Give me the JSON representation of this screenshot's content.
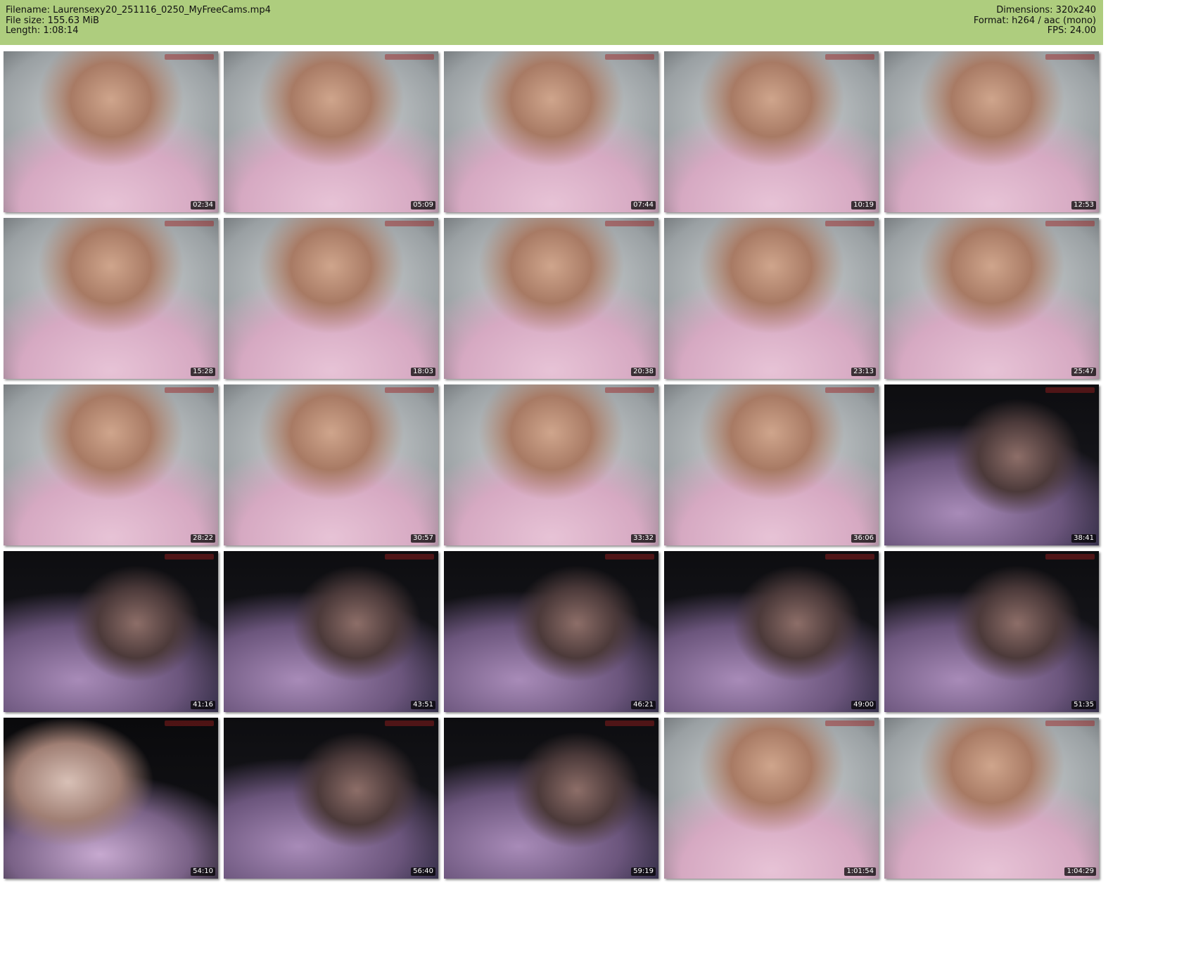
{
  "header": {
    "filename": "Filename: Laurensexy20_251116_0250_MyFreeCams.mp4",
    "filesize": "File size: 155.63 MiB",
    "length": "Length: 1:08:14",
    "dimensions": "Dimensions: 320x240",
    "format": "Format: h264 / aac (mono)",
    "fps": "FPS: 24.00"
  },
  "frames": [
    {
      "ts": "02:34",
      "scene": "lit"
    },
    {
      "ts": "05:09",
      "scene": "lit"
    },
    {
      "ts": "07:44",
      "scene": "lit"
    },
    {
      "ts": "10:19",
      "scene": "lit"
    },
    {
      "ts": "12:53",
      "scene": "lit"
    },
    {
      "ts": "15:28",
      "scene": "lit"
    },
    {
      "ts": "18:03",
      "scene": "lit"
    },
    {
      "ts": "20:38",
      "scene": "lit"
    },
    {
      "ts": "23:13",
      "scene": "lit"
    },
    {
      "ts": "25:47",
      "scene": "lit"
    },
    {
      "ts": "28:22",
      "scene": "lit"
    },
    {
      "ts": "30:57",
      "scene": "lit"
    },
    {
      "ts": "33:32",
      "scene": "lit"
    },
    {
      "ts": "36:06",
      "scene": "lit"
    },
    {
      "ts": "38:41",
      "scene": "dim"
    },
    {
      "ts": "41:16",
      "scene": "dim"
    },
    {
      "ts": "43:51",
      "scene": "dim"
    },
    {
      "ts": "46:21",
      "scene": "dim"
    },
    {
      "ts": "49:00",
      "scene": "dim"
    },
    {
      "ts": "51:35",
      "scene": "dim"
    },
    {
      "ts": "54:10",
      "scene": "dark"
    },
    {
      "ts": "56:40",
      "scene": "dim"
    },
    {
      "ts": "59:19",
      "scene": "dim"
    },
    {
      "ts": "1:01:54",
      "scene": "lit"
    },
    {
      "ts": "1:04:29",
      "scene": "lit"
    }
  ]
}
